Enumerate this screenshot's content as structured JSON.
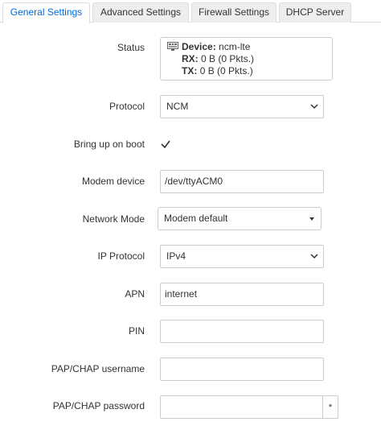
{
  "tabs": [
    {
      "label": "General Settings",
      "active": true
    },
    {
      "label": "Advanced Settings",
      "active": false
    },
    {
      "label": "Firewall Settings",
      "active": false
    },
    {
      "label": "DHCP Server",
      "active": false
    }
  ],
  "status": {
    "label": "Status",
    "icon": "network-interface-icon",
    "device_key": "Device:",
    "device_value": "ncm-lte",
    "rx_key": "RX:",
    "rx_value": "0 B (0 Pkts.)",
    "tx_key": "TX:",
    "tx_value": "0 B (0 Pkts.)"
  },
  "protocol": {
    "label": "Protocol",
    "value": "NCM"
  },
  "boot": {
    "label": "Bring up on boot",
    "checked": true
  },
  "modem_device": {
    "label": "Modem device",
    "value": "/dev/ttyACM0"
  },
  "network_mode": {
    "label": "Network Mode",
    "value": "Modem default"
  },
  "ip_protocol": {
    "label": "IP Protocol",
    "value": "IPv4"
  },
  "apn": {
    "label": "APN",
    "value": "internet"
  },
  "pin": {
    "label": "PIN",
    "value": ""
  },
  "pap_username": {
    "label": "PAP/CHAP username",
    "value": ""
  },
  "pap_password": {
    "label": "PAP/CHAP password",
    "value": "",
    "toggle_label": "*"
  },
  "colors": {
    "accent": "#0069d6",
    "border": "#cccccc",
    "tab_bg": "#eeeeee"
  }
}
